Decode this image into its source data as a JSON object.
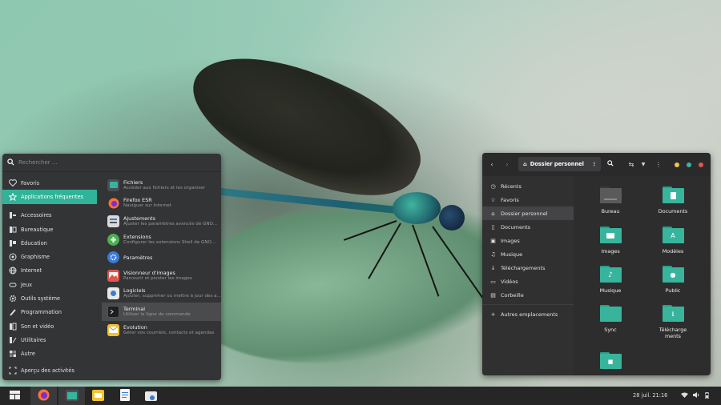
{
  "menu": {
    "search_placeholder": "Rechercher ...",
    "categories": [
      {
        "label": "Favoris",
        "icon": "heart-icon"
      },
      {
        "label": "Applications fréquentes",
        "icon": "star-icon"
      },
      {
        "label": "Accessoires",
        "icon": "accessories-icon"
      },
      {
        "label": "Bureautique",
        "icon": "office-icon"
      },
      {
        "label": "Éducation",
        "icon": "education-icon"
      },
      {
        "label": "Graphisme",
        "icon": "graphics-icon"
      },
      {
        "label": "Internet",
        "icon": "globe-icon"
      },
      {
        "label": "Jeux",
        "icon": "gamepad-icon"
      },
      {
        "label": "Outils système",
        "icon": "gear-icon"
      },
      {
        "label": "Programmation",
        "icon": "programming-icon"
      },
      {
        "label": "Son et vidéo",
        "icon": "multimedia-icon"
      },
      {
        "label": "Utilitaires",
        "icon": "utilities-icon"
      },
      {
        "label": "Autre",
        "icon": "other-icon"
      }
    ],
    "overview_label": "Aperçu des activités",
    "apps": [
      {
        "name": "Fichiers",
        "desc": "Accéder aux fichiers et les organiser",
        "icon": "files-icon",
        "color": "#4a4f55"
      },
      {
        "name": "Firefox ESR",
        "desc": "Naviguer sur Internet",
        "icon": "firefox-icon",
        "color": "#ff7139"
      },
      {
        "name": "Ajustements",
        "desc": "Ajuster les paramètres avancés de GNO...",
        "icon": "tweaks-icon",
        "color": "#d9d9d9"
      },
      {
        "name": "Extensions",
        "desc": "Configurer les extensions Shell de GNO...",
        "icon": "extensions-icon",
        "color": "#4caf50"
      },
      {
        "name": "Paramètres",
        "desc": "",
        "icon": "settings-icon",
        "color": "#3a7bd5"
      },
      {
        "name": "Visionneur d'images",
        "desc": "Parcourir et pivoter les images",
        "icon": "image-viewer-icon",
        "color": "#e0564a"
      },
      {
        "name": "Logiciels",
        "desc": "Ajouter, supprimer ou mettre à jour des a...",
        "icon": "software-icon",
        "color": "#e8e8e8"
      },
      {
        "name": "Terminal",
        "desc": "Utiliser la ligne de commande",
        "icon": "terminal-icon",
        "color": "#1e1e1e"
      },
      {
        "name": "Evolution",
        "desc": "Gérer vos courriels, contacts et agendas",
        "icon": "mail-icon",
        "color": "#f2c230"
      }
    ]
  },
  "file_manager": {
    "path_label": "Dossier personnel",
    "sidebar": [
      {
        "label": "Récents",
        "icon": "clock-icon"
      },
      {
        "label": "Favoris",
        "icon": "star-icon"
      },
      {
        "label": "Dossier personnel",
        "icon": "home-icon"
      },
      {
        "label": "Documents",
        "icon": "document-icon"
      },
      {
        "label": "Images",
        "icon": "image-icon"
      },
      {
        "label": "Musique",
        "icon": "music-icon"
      },
      {
        "label": "Téléchargements",
        "icon": "download-icon"
      },
      {
        "label": "Vidéos",
        "icon": "video-icon"
      },
      {
        "label": "Corbeille",
        "icon": "trash-icon"
      },
      {
        "label": "Autres emplacements",
        "icon": "plus-icon"
      }
    ],
    "folders": [
      {
        "label": "Bureau",
        "icon": "desktop-folder-icon"
      },
      {
        "label": "Documents",
        "icon": "documents-folder-icon"
      },
      {
        "label": "Images",
        "icon": "pictures-folder-icon"
      },
      {
        "label": "Modèles",
        "icon": "templates-folder-icon"
      },
      {
        "label": "Musique",
        "icon": "music-folder-icon"
      },
      {
        "label": "Public",
        "icon": "public-folder-icon"
      },
      {
        "label": "Sync",
        "icon": "sync-folder-icon"
      },
      {
        "label": "Téléchargements",
        "icon": "downloads-folder-icon"
      },
      {
        "label": "",
        "icon": "videos-folder-icon"
      }
    ],
    "window_buttons": {
      "minimize": "#e8c84a",
      "maximize": "#3bb59c",
      "close": "#e05555"
    }
  },
  "taskbar": {
    "clock": "28 juil.  21:16",
    "apps": [
      "app-grid-icon",
      "firefox-icon",
      "files-icon",
      "mail-icon",
      "text-editor-icon",
      "software-icon"
    ]
  },
  "colors": {
    "accent": "#30b398",
    "panel": "#333436"
  }
}
